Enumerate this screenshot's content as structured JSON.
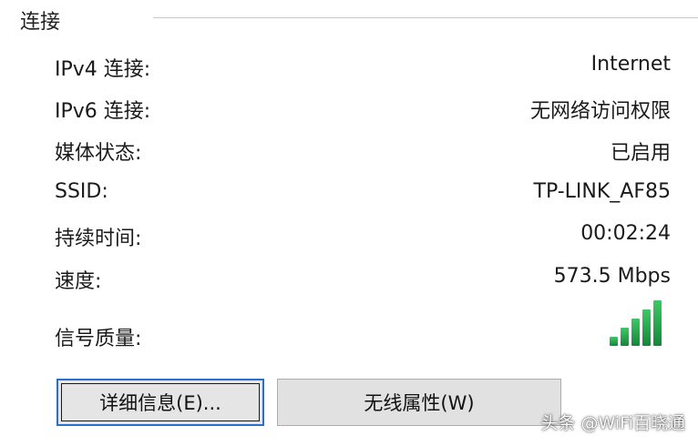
{
  "group": {
    "title": "连接"
  },
  "rows": [
    {
      "label": "IPv4 连接:",
      "value": "Internet"
    },
    {
      "label": "IPv6 连接:",
      "value": "无网络访问权限"
    },
    {
      "label": "媒体状态:",
      "value": "已启用"
    },
    {
      "label": "SSID:",
      "value": "TP-LINK_AF85"
    },
    {
      "label": "持续时间:",
      "value": "00:02:24"
    },
    {
      "label": "速度:",
      "value": "573.5 Mbps"
    }
  ],
  "signal": {
    "label": "信号质量:",
    "level": 5,
    "max": 5,
    "color": "#2aa84a"
  },
  "buttons": {
    "details": "详细信息(E)...",
    "wireless": "无线属性(W)"
  },
  "watermark": "头条 @WiFi百晓通"
}
